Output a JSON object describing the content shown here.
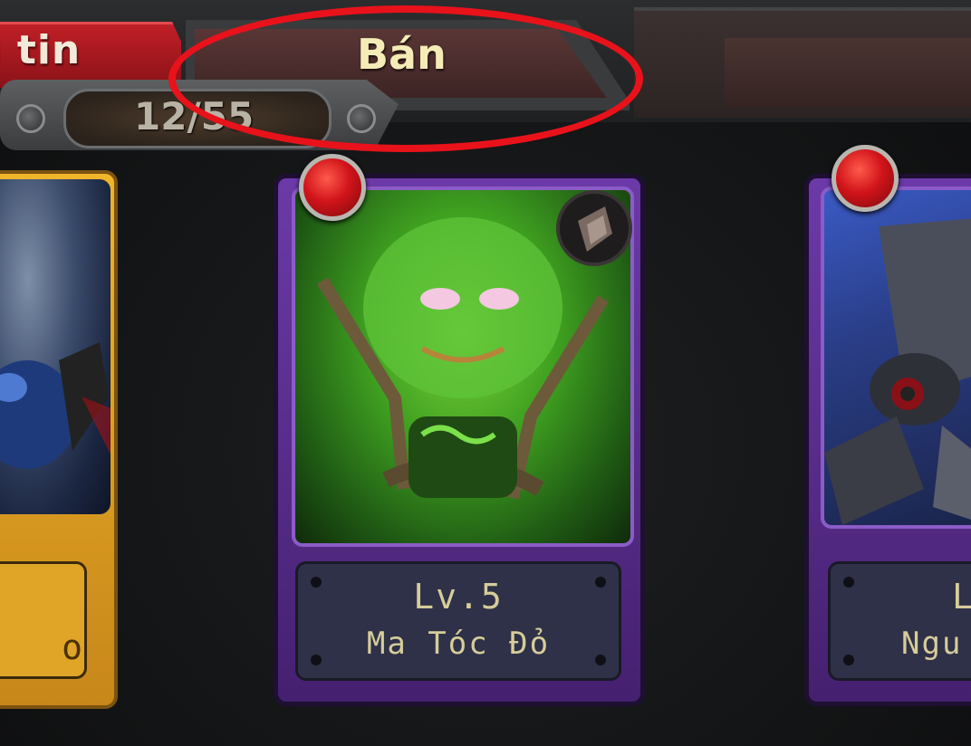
{
  "tabs": {
    "info_label": "g tin",
    "sell_label": "Bán"
  },
  "inventory": {
    "count": "12/55"
  },
  "cards": [
    {
      "level": "",
      "name": "o"
    },
    {
      "level": "Lv.5",
      "name": "Ma Tóc Đỏ"
    },
    {
      "level": "L",
      "name": "Ngu"
    }
  ],
  "colors": {
    "highlight": "#e8121b",
    "info_tab": "#c01f26",
    "sell_tab_text": "#f4ebb6",
    "card_gold": "#d99b20",
    "card_purple": "#5a2c91",
    "plaque_text": "#d7cc9a"
  }
}
